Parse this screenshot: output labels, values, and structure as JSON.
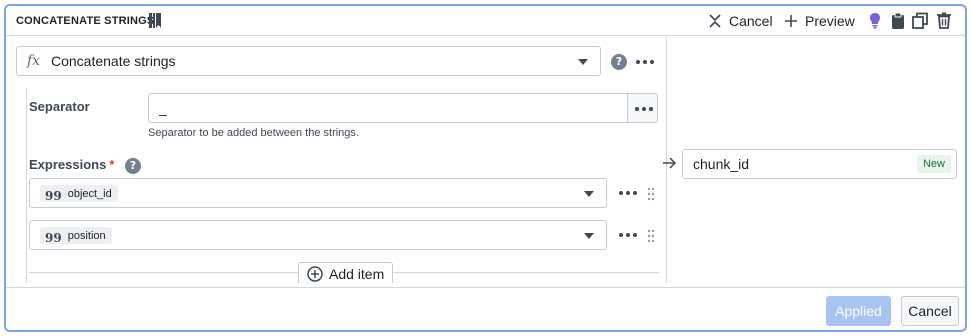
{
  "header": {
    "title": "CONCATENATE STRINGS",
    "cancel_label": "Cancel",
    "preview_label": "Preview",
    "icons": [
      "book-icon",
      "close-icon",
      "plus-icon",
      "lightbulb-icon",
      "clipboard-icon",
      "duplicate-icon",
      "trash-icon"
    ]
  },
  "function": {
    "icon_glyph": "fx",
    "name": "Concatenate strings"
  },
  "separator": {
    "label": "Separator",
    "value": "_",
    "helper": "Separator to be added between the strings."
  },
  "expressions": {
    "label": "Expressions",
    "required_mark": "*",
    "items": [
      {
        "quote_glyph": "99",
        "label": "object_id"
      },
      {
        "quote_glyph": "99",
        "label": "position"
      }
    ],
    "add_label": "Add item"
  },
  "output": {
    "name": "chunk_id",
    "badge": "New"
  },
  "footer": {
    "applied_label": "Applied",
    "cancel_label": "Cancel"
  },
  "colors": {
    "frame_border": "#7ea4e8",
    "lightbulb": "#7961db",
    "applied_bg": "#a8c4f0",
    "new_badge_bg": "#e8f4ea",
    "new_badge_text": "#1c6e42",
    "required": "#cd4246"
  }
}
